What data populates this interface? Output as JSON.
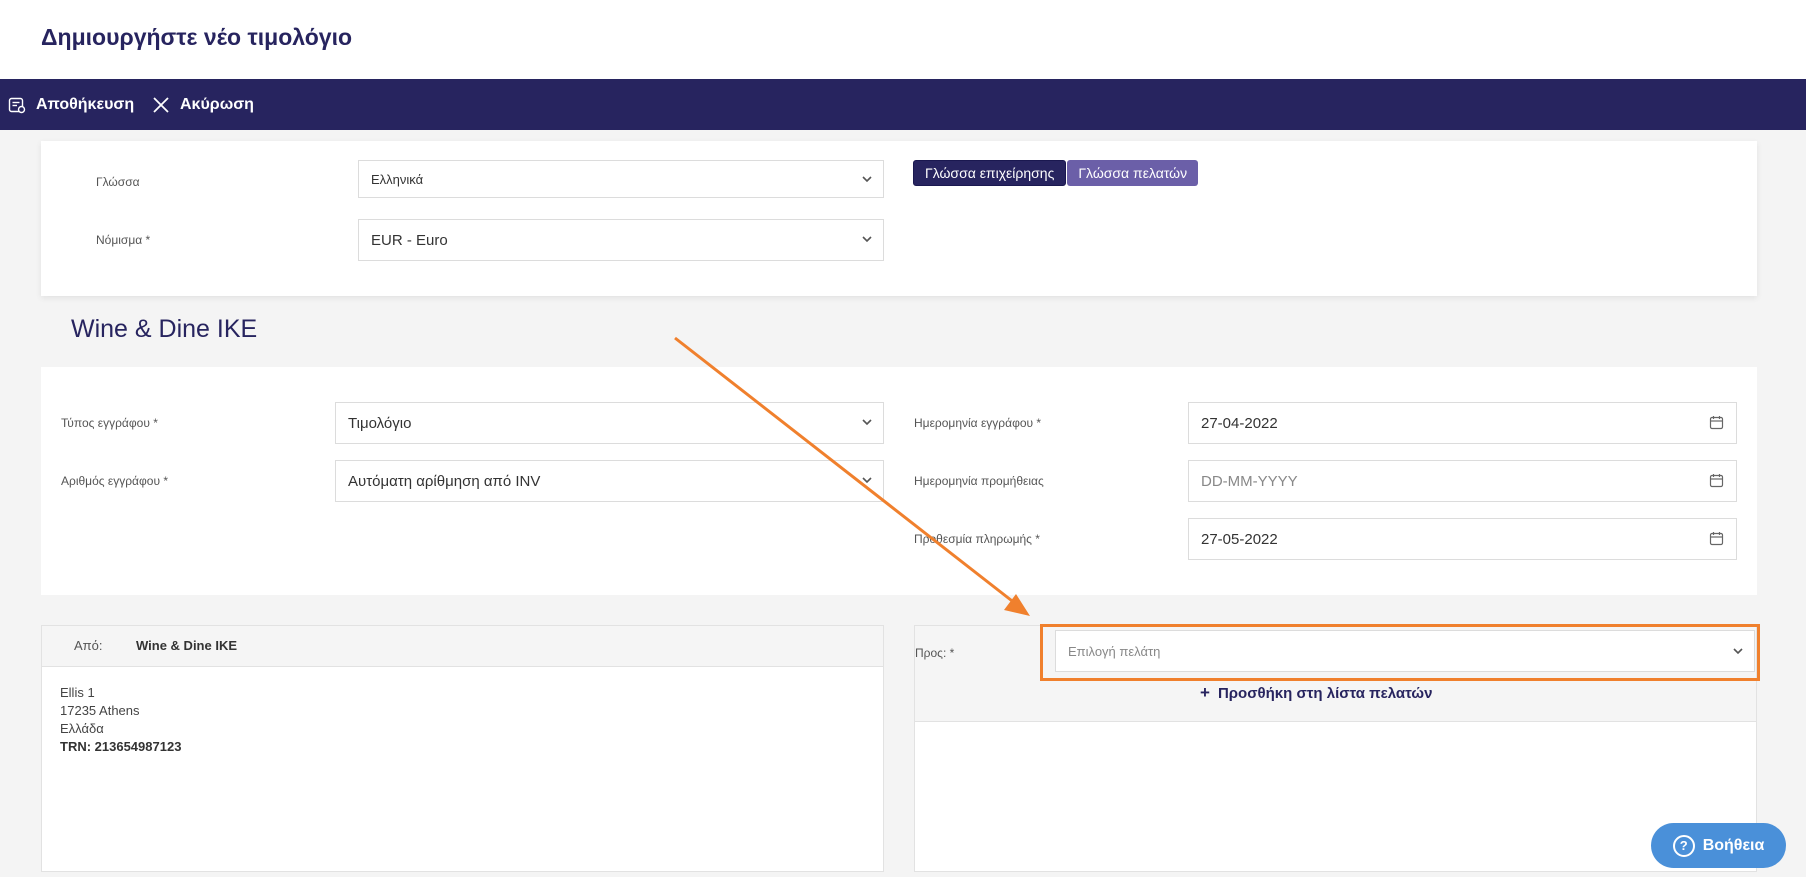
{
  "header": {
    "title": "Δημιουργήστε νέο τιμολόγιο"
  },
  "toolbar": {
    "save_label": "Αποθήκευση",
    "cancel_label": "Ακύρωση"
  },
  "language_section": {
    "language_label": "Γλώσσα",
    "language_value": "Ελληνικά",
    "currency_label": "Νόμισμα *",
    "currency_value": "EUR - Euro",
    "toggle": {
      "business": "Γλώσσα επιχείρησης",
      "client": "Γλώσσα πελατών",
      "active": "business"
    }
  },
  "company": {
    "name": "Wine & Dine IKE"
  },
  "document": {
    "type_label": "Τύπος εγγράφου *",
    "type_value": "Τιμολόγιο",
    "number_label": "Αριθμός εγγράφου *",
    "number_value": "Αυτόματη αρίθμηση από INV",
    "date_label": "Ημερομηνία εγγράφου *",
    "date_value": "27-04-2022",
    "delivery_label": "Ημερομηνία προμήθειας",
    "delivery_placeholder": "DD-MM-YYYY",
    "due_label": "Προθεσμία πληρωμής *",
    "due_value": "27-05-2022"
  },
  "from": {
    "label": "Από:",
    "name": "Wine & Dine IKE",
    "address_line1": "Ellis 1",
    "address_line2": "17235 Athens",
    "country": "Ελλάδα",
    "trn": "TRN: 213654987123"
  },
  "to": {
    "label": "Προς: *",
    "client_placeholder": "Επιλογή πελάτη",
    "add_client_label": "Προσθήκη στη λίστα πελατών"
  },
  "help": {
    "label": "Βοήθεια"
  },
  "colors": {
    "brand": "#27245f",
    "annotation": "#f0802d",
    "help": "#4a90d9"
  }
}
